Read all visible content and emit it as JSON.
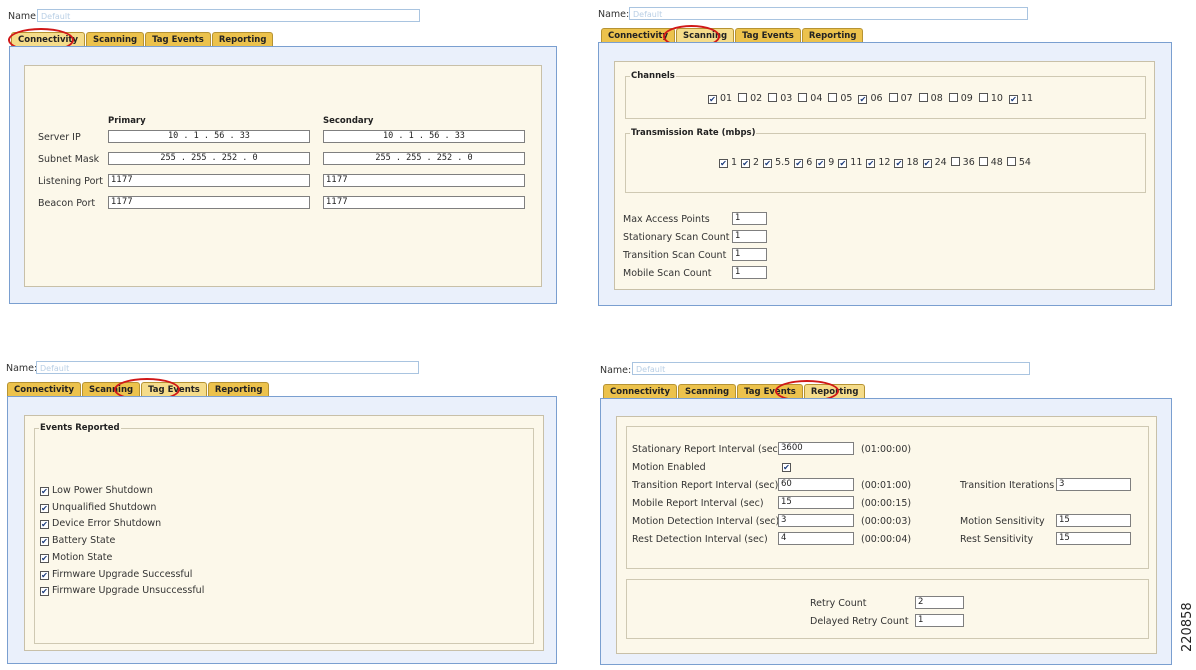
{
  "name_label": "Name:",
  "name_placeholder": "Default",
  "tabs": [
    "Connectivity",
    "Scanning",
    "Tag Events",
    "Reporting"
  ],
  "connectivity": {
    "primary_header": "Primary",
    "secondary_header": "Secondary",
    "rows": [
      {
        "label": "Server IP",
        "primary": "10  .  1  .  56  .  33",
        "secondary": "10  .  1  .  56  .  33"
      },
      {
        "label": "Subnet Mask",
        "primary": "255 . 255 . 252 .  0",
        "secondary": "255 . 255 . 252 .  0"
      },
      {
        "label": "Listening Port",
        "primary": "1177",
        "secondary": "1177"
      },
      {
        "label": "Beacon Port",
        "primary": "1177",
        "secondary": "1177"
      }
    ]
  },
  "scanning": {
    "channels_title": "Channels",
    "channels": [
      {
        "label": "01",
        "checked": true
      },
      {
        "label": "02",
        "checked": false
      },
      {
        "label": "03",
        "checked": false
      },
      {
        "label": "04",
        "checked": false
      },
      {
        "label": "05",
        "checked": false
      },
      {
        "label": "06",
        "checked": true
      },
      {
        "label": "07",
        "checked": false
      },
      {
        "label": "08",
        "checked": false
      },
      {
        "label": "09",
        "checked": false
      },
      {
        "label": "10",
        "checked": false
      },
      {
        "label": "11",
        "checked": true
      }
    ],
    "rate_title": "Transmission Rate (mbps)",
    "rates": [
      {
        "label": "1",
        "checked": true
      },
      {
        "label": "2",
        "checked": true
      },
      {
        "label": "5.5",
        "checked": true
      },
      {
        "label": "6",
        "checked": true
      },
      {
        "label": "9",
        "checked": true
      },
      {
        "label": "11",
        "checked": true
      },
      {
        "label": "12",
        "checked": true
      },
      {
        "label": "18",
        "checked": true
      },
      {
        "label": "24",
        "checked": true
      },
      {
        "label": "36",
        "checked": false
      },
      {
        "label": "48",
        "checked": false
      },
      {
        "label": "54",
        "checked": false
      }
    ],
    "fields": [
      {
        "label": "Max Access Points",
        "value": "1"
      },
      {
        "label": "Stationary Scan Count",
        "value": "1"
      },
      {
        "label": "Transition Scan Count",
        "value": "1"
      },
      {
        "label": "Mobile Scan Count",
        "value": "1"
      }
    ]
  },
  "tag_events": {
    "title": "Events Reported",
    "events": [
      {
        "label": "Low Power Shutdown",
        "checked": true
      },
      {
        "label": "Unqualified Shutdown",
        "checked": true
      },
      {
        "label": "Device Error Shutdown",
        "checked": true
      },
      {
        "label": "Battery State",
        "checked": true
      },
      {
        "label": "Motion State",
        "checked": true
      },
      {
        "label": "Firmware Upgrade Successful",
        "checked": true
      },
      {
        "label": "Firmware Upgrade Unsuccessful",
        "checked": true
      }
    ]
  },
  "reporting": {
    "stationary_label": "Stationary Report Interval (sec)",
    "stationary_value": "3600",
    "stationary_hms": "(01:00:00)",
    "motion_enabled_label": "Motion Enabled",
    "motion_enabled_checked": true,
    "transition_label": "Transition Report Interval (sec)",
    "transition_value": "60",
    "transition_hms": "(00:01:00)",
    "transition_iter_label": "Transition Iterations",
    "transition_iter_value": "3",
    "mobile_label": "Mobile Report Interval (sec)",
    "mobile_value": "15",
    "mobile_hms": "(00:00:15)",
    "motion_det_label": "Motion Detection Interval (sec)",
    "motion_det_value": "3",
    "motion_det_hms": "(00:00:03)",
    "motion_sens_label": "Motion Sensitivity",
    "motion_sens_value": "15",
    "rest_det_label": "Rest Detection Interval (sec)",
    "rest_det_value": "4",
    "rest_det_hms": "(00:00:04)",
    "rest_sens_label": "Rest Sensitivity",
    "rest_sens_value": "15",
    "retry_label": "Retry Count",
    "retry_value": "2",
    "delayed_retry_label": "Delayed Retry Count",
    "delayed_retry_value": "1"
  },
  "figure_id": "220858",
  "colors": {
    "tab": "#ecc24c",
    "highlight": "#d01818",
    "panel_bg": "#fcf8ea",
    "frame_border": "#7a9fd0"
  }
}
